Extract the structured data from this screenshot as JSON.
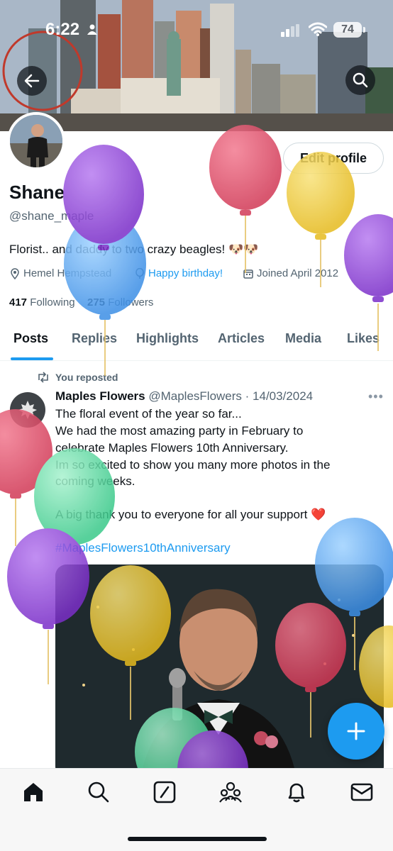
{
  "status_bar": {
    "time": "6:22",
    "battery": "74"
  },
  "profile": {
    "name": "Shane",
    "handle": "@shane_maple",
    "bio": "Florist.. and daddy to two crazy beagles! 🐶🐶",
    "location": "Hemel Hempstead",
    "birthday": "Happy birthday!",
    "joined": "Joined April 2012",
    "following_count": "417",
    "following_label": "Following",
    "followers_count": "275",
    "followers_label": "Followers",
    "edit_label": "Edit profile"
  },
  "tabs": [
    {
      "label": "Posts"
    },
    {
      "label": "Replies"
    },
    {
      "label": "Highlights"
    },
    {
      "label": "Articles"
    },
    {
      "label": "Media"
    },
    {
      "label": "Likes"
    }
  ],
  "post": {
    "repost_label": "You reposted",
    "author": "Maples Flowers",
    "handle": "@MaplesFlowers",
    "date": "· 14/03/2024",
    "lines": [
      "The floral event of the year so far...",
      "We had the most amazing party in February to",
      "celebrate Maples Flowers 10th Anniversary.",
      "Im so excited to show you many more photos in the",
      "coming weeks.",
      "A big thank you to everyone for all your support ❤️"
    ],
    "hashtag": "#MaplesFlowers10thAnniversary"
  },
  "colors": {
    "accent": "#1d9bf0",
    "text": "#0f1419",
    "muted": "#536471"
  },
  "icons": [
    "back-arrow-icon",
    "search-icon",
    "home-icon",
    "explore-icon",
    "grok-icon",
    "communities-icon",
    "notifications-icon",
    "messages-icon",
    "compose-plus-icon"
  ]
}
